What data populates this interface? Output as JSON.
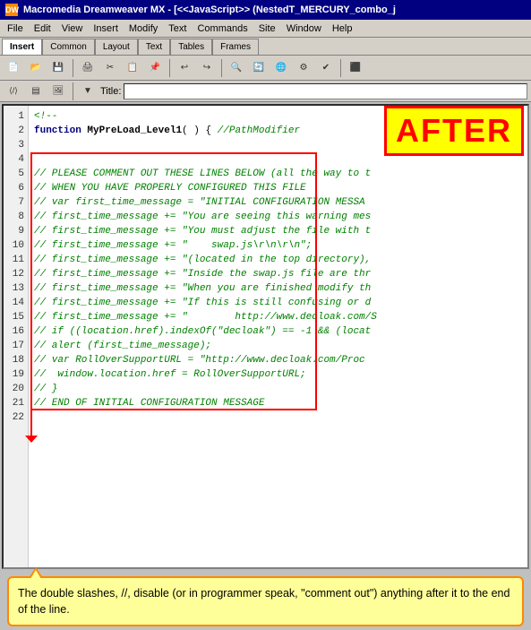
{
  "window": {
    "title": "Macromedia Dreamweaver MX - [<<JavaScript>> (NestedT_MERCURY_combo_j",
    "icon": "DW"
  },
  "menubar": {
    "items": [
      "File",
      "Edit",
      "View",
      "Insert",
      "Modify",
      "Text",
      "Commands",
      "Site",
      "Window",
      "Help"
    ]
  },
  "tabs": {
    "insert_label": "Insert",
    "items": [
      "Common",
      "Layout",
      "Text",
      "Tables",
      "Frames"
    ]
  },
  "title_row": {
    "label": "Title:",
    "value": ""
  },
  "after_badge": "AFTER",
  "code": {
    "lines": [
      {
        "num": "1",
        "text": "<!--"
      },
      {
        "num": "2",
        "text": "function MyPreLoad_Level1( ) { //PathModifier"
      },
      {
        "num": "3",
        "text": ""
      },
      {
        "num": "4",
        "text": ""
      },
      {
        "num": "5",
        "text": "// PLEASE COMMENT OUT THESE LINES BELOW (all the way to t"
      },
      {
        "num": "6",
        "text": "// WHEN YOU HAVE PROPERLY CONFIGURED THIS FILE"
      },
      {
        "num": "7",
        "text": "// var first_time_message = \"INITIAL CONFIGURATION MESSA"
      },
      {
        "num": "8",
        "text": "// first_time_message += \"You are seeing this warning mes"
      },
      {
        "num": "9",
        "text": "// first_time_message += \"You must adjust the file with t"
      },
      {
        "num": "10",
        "text": "// first_time_message += \"    swap.js\\r\\n\\r\\n\";"
      },
      {
        "num": "11",
        "text": "// first_time_message += \"(located in the top directory),"
      },
      {
        "num": "12",
        "text": "// first_time_message += \"Inside the swap.js file are thr"
      },
      {
        "num": "13",
        "text": "// first_time_message += \"When you are finished modify th"
      },
      {
        "num": "14",
        "text": "// first_time_message += \"If this is still confusing or d"
      },
      {
        "num": "15",
        "text": "// first_time_message += \"        http://www.decloak.com/S"
      },
      {
        "num": "16",
        "text": "// if ((location.href).indexOf(\"decloak\") == -1 && (locat"
      },
      {
        "num": "17",
        "text": "//  alert (first_time_message);"
      },
      {
        "num": "18",
        "text": "// var RollOverSupportURL = \"http://www.decloak.com/Proc"
      },
      {
        "num": "19",
        "text": "//  window.location.href = RollOverSupportURL;"
      },
      {
        "num": "20",
        "text": "// }"
      },
      {
        "num": "21",
        "text": "// END OF INITIAL CONFIGURATION MESSAGE"
      },
      {
        "num": "22",
        "text": ""
      }
    ]
  },
  "callout": {
    "text": "The double slashes, //, disable (or in programmer speak, \"comment out\") anything after it to the end of the line."
  }
}
